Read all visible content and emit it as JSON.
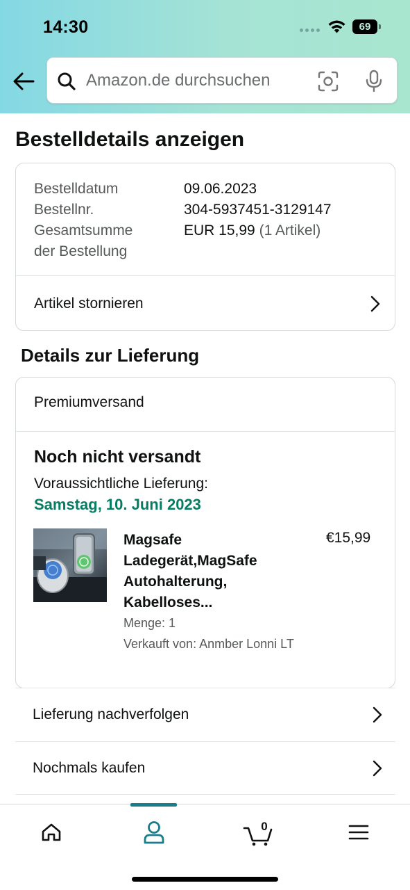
{
  "status_bar": {
    "time": "14:30",
    "battery": "69"
  },
  "search": {
    "placeholder": "Amazon.de durchsuchen"
  },
  "page_title": "Bestelldetails anzeigen",
  "order": {
    "rows": [
      {
        "label": "Bestelldatum",
        "value": "09.06.2023"
      },
      {
        "label": "Bestellnr.",
        "value": "304-5937451-3129147"
      }
    ],
    "total_label_line1": "Gesamtsumme",
    "total_label_line2": "der Bestellung",
    "total_value": "EUR 15,99",
    "total_items": "(1 Artikel)",
    "cancel_label": "Artikel stornieren"
  },
  "delivery": {
    "section_title": "Details zur Lieferung",
    "shipping_speed": "Premiumversand",
    "status": "Noch nicht versandt",
    "estimate_label": "Voraussichtliche Lieferung:",
    "estimate_date": "Samstag, 10. Juni 2023",
    "accent_color": "#067d62",
    "product": {
      "title_line1": "Magsafe",
      "title_line2": "Ladegerät,MagSafe",
      "title_line3": "Autohalterung,",
      "title_line4": "Kabelloses...",
      "price": "€15,99",
      "quantity": "Menge: 1",
      "seller": "Verkauft von: Anmber Lonni LT"
    }
  },
  "actions": {
    "track": "Lieferung nachverfolgen",
    "buy_again": "Nochmals kaufen"
  },
  "tabbar": {
    "active_tab": "account",
    "cart_count": "0",
    "indicator_color": "#1b7d8c"
  }
}
